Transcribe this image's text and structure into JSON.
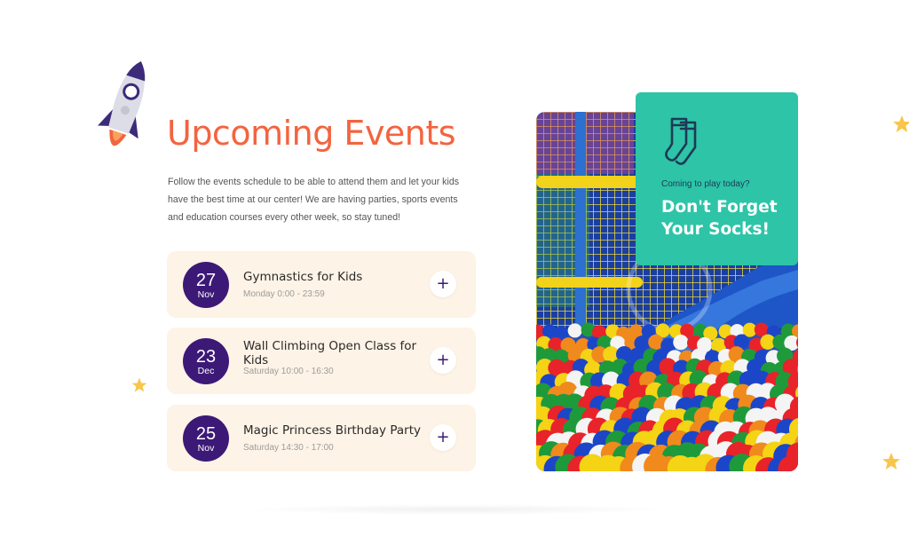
{
  "section": {
    "title": "Upcoming Events",
    "intro": "Follow the events schedule to be able to attend them and let your kids have the best time at our center! We are having parties, sports events and education courses every other week, so stay tuned!"
  },
  "events": [
    {
      "day": "27",
      "month": "Nov",
      "title": "Gymnastics for Kids",
      "time": "Monday 0:00 - 23:59",
      "action": "+"
    },
    {
      "day": "23",
      "month": "Dec",
      "title": "Wall Climbing Open Class for Kids",
      "time": "Saturday 10:00 - 16:30",
      "action": "+"
    },
    {
      "day": "25",
      "month": "Nov",
      "title": "Magic Princess Birthday Party",
      "time": "Saturday 14:30 - 17:00",
      "action": "+"
    }
  ],
  "callout": {
    "subtitle": "Coming to play today?",
    "title": "Don't Forget Your Socks!",
    "icon": "socks-icon"
  },
  "colors": {
    "accent": "#f3643f",
    "badge": "#3c1976",
    "card": "#fdf3e6",
    "callout": "#2ec4a7",
    "star": "#f7c64a"
  }
}
